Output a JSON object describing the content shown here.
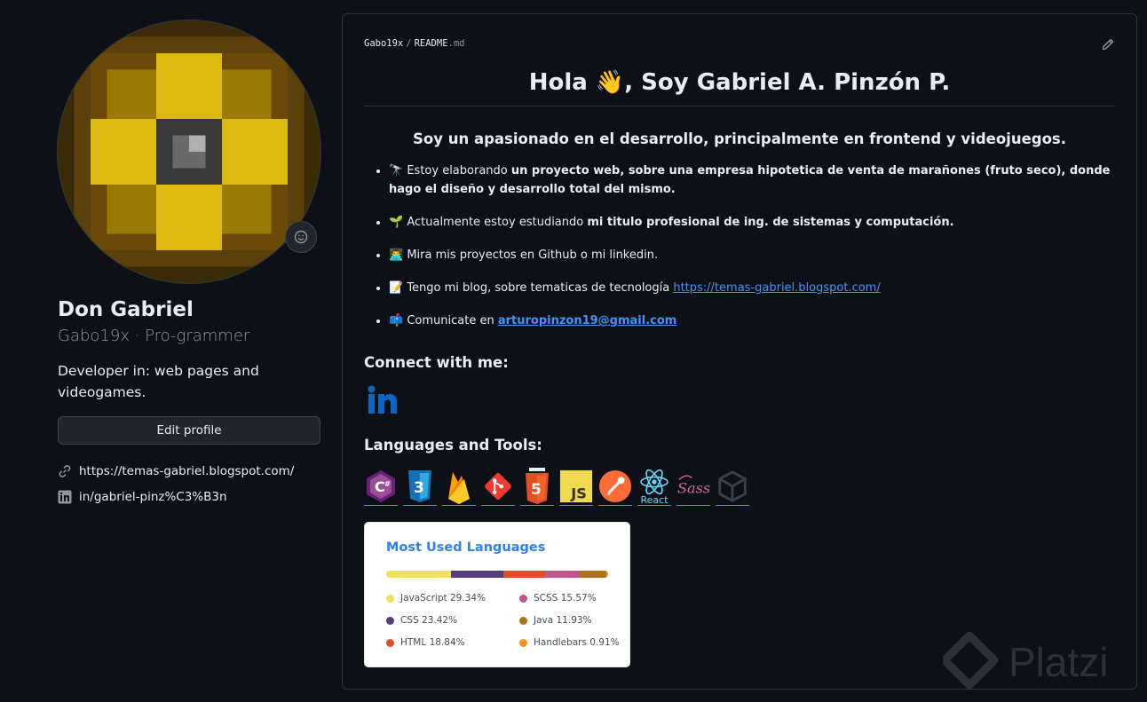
{
  "profile": {
    "name": "Don Gabriel",
    "login": "Gabo19x",
    "separator": " · ",
    "pronouns": "Pro-grammer",
    "bio": "Developer in: web pages and videogames.",
    "edit_label": "Edit profile",
    "website": "https://temas-gabriel.blogspot.com/",
    "linkedin": "in/gabriel-pinz%C3%B3n"
  },
  "readme": {
    "crumb_user": "Gabo19x",
    "crumb_sep": "/",
    "crumb_file": "README",
    "crumb_ext": ".md",
    "title": "Hola 👋, Soy Gabriel A. Pinzón P.",
    "subtitle": "Soy un apasionado en el desarrollo, principalmente en frontend y videojuegos.",
    "items": [
      {
        "emoji": "🔭",
        "text": "Estoy elaborando ",
        "bold": "un proyecto web, sobre una empresa hipotetica de venta de marañones (fruto seco), donde hago el diseño y desarrollo total del mismo.",
        "link": ""
      },
      {
        "emoji": "🌱",
        "text": "Actualmente estoy estudiando ",
        "bold": "mi titulo profesional de ing. de sistemas y computación.",
        "link": ""
      },
      {
        "emoji": "👨‍💻",
        "text": "Mira mis proyectos en Github o mi linkedin.",
        "bold": "",
        "link": ""
      },
      {
        "emoji": "📝",
        "text": "Tengo mi blog, sobre tematicas de tecnología ",
        "bold": "",
        "link": "https://temas-gabriel.blogspot.com/"
      },
      {
        "emoji": "📫",
        "text": "Comunicate en ",
        "bold": "",
        "link": "arturopinzon19@gmail.com"
      }
    ],
    "connect_heading": "Connect with me:",
    "languages_heading": "Languages and Tools:",
    "tools": [
      "csharp-icon",
      "css3-icon",
      "firebase-icon",
      "git-icon",
      "html5-icon",
      "javascript-icon",
      "postman-icon",
      "react-icon",
      "sass-icon",
      "unity-icon"
    ],
    "react_label": "React"
  },
  "stats_card": {
    "title": "Most Used Languages",
    "languages": [
      {
        "name": "JavaScript",
        "percent": "29.34%",
        "value": 29.34,
        "color": "#f1e05a"
      },
      {
        "name": "CSS",
        "percent": "23.42%",
        "value": 23.42,
        "color": "#563d7c"
      },
      {
        "name": "HTML",
        "percent": "18.84%",
        "value": 18.84,
        "color": "#e34c26"
      },
      {
        "name": "SCSS",
        "percent": "15.57%",
        "value": 15.57,
        "color": "#c6538c"
      },
      {
        "name": "Java",
        "percent": "11.93%",
        "value": 11.93,
        "color": "#b07219"
      },
      {
        "name": "Handlebars",
        "percent": "0.91%",
        "value": 0.91,
        "color": "#f7931e"
      }
    ]
  },
  "watermark": "Platzi"
}
